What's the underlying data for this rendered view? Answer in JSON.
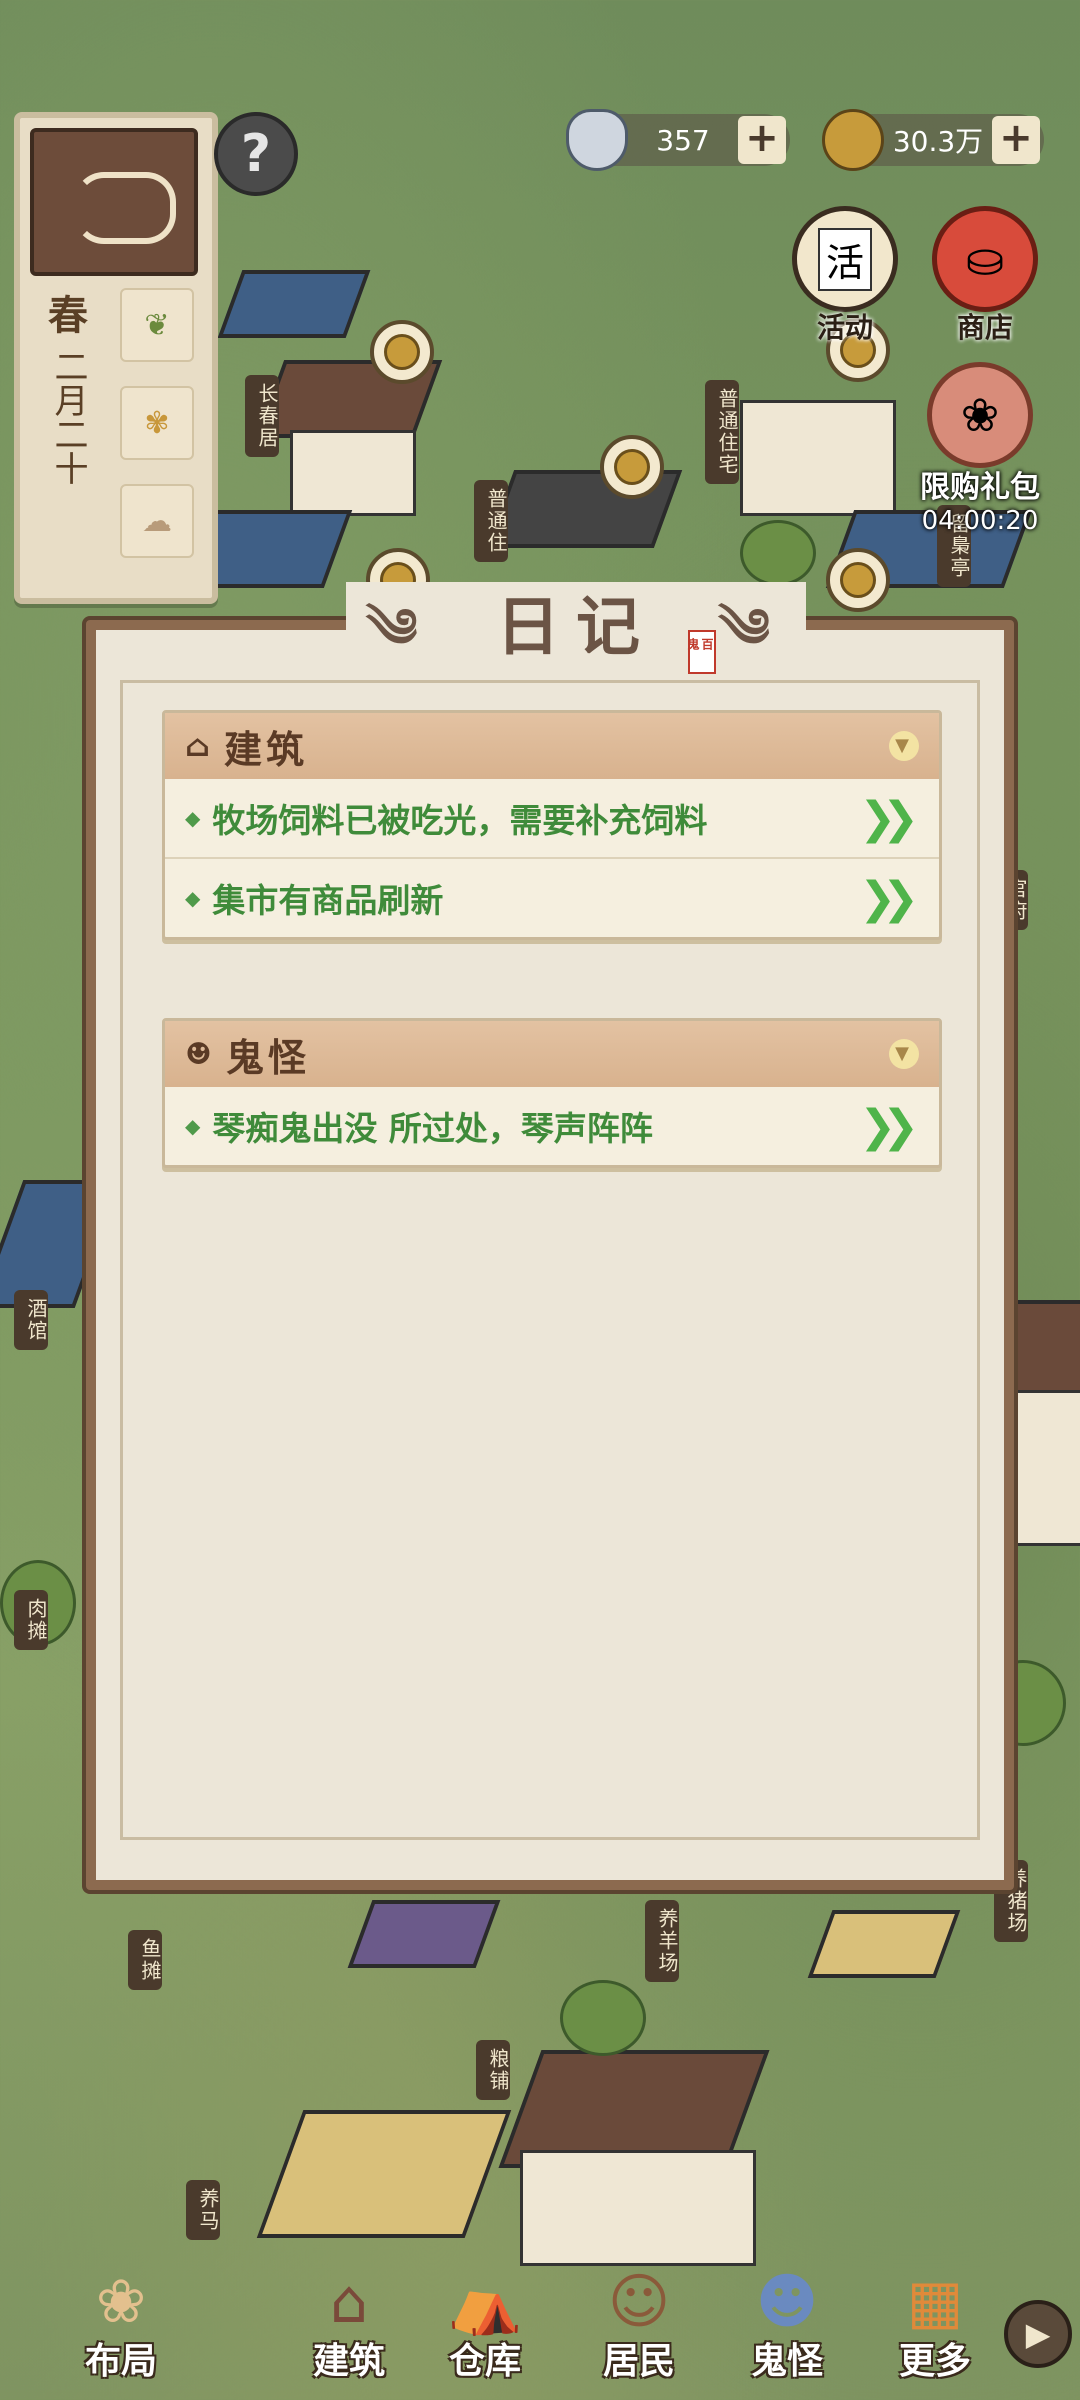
{
  "hud": {
    "silver": "357",
    "coins": "30.3万",
    "help": "?"
  },
  "calendar": {
    "season": "春",
    "date": "二月二十"
  },
  "top_buttons": {
    "activity": "活动",
    "activity_icon": "活",
    "shop": "商店",
    "gift": "限购礼包",
    "gift_timer": "04:00:20"
  },
  "map_labels": [
    "长春居",
    "普通住宅",
    "普通住",
    "留梟亭",
    "官府",
    "酒馆",
    "肉摊",
    "鱼摊",
    "养羊场",
    "粮铺",
    "养猪场",
    "养马"
  ],
  "diary": {
    "title": "日记",
    "seal": "百鬼",
    "sections": [
      {
        "title": "建筑",
        "icon": "home-icon",
        "items": [
          "牧场饲料已被吃光，需要补充饲料",
          "集市有商品刷新"
        ]
      },
      {
        "title": "鬼怪",
        "icon": "ghost-icon",
        "items": [
          "琴痴鬼出没 所过处，琴声阵阵"
        ]
      }
    ]
  },
  "nav": {
    "layout": "布局",
    "build": "建筑",
    "storage": "仓库",
    "residents": "居民",
    "ghosts": "鬼怪",
    "more": "更多"
  },
  "colors": {
    "green_text": "#3f8b3a",
    "modal_border": "#8c6a4f",
    "section_head": "#d8b28e"
  }
}
